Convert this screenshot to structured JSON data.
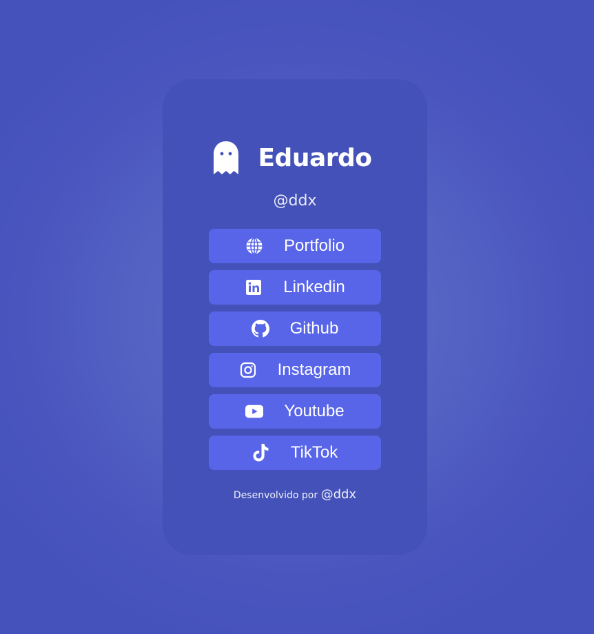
{
  "profile": {
    "name": "Eduardo",
    "handle": "@ddx",
    "avatar_icon": "ghost-icon"
  },
  "links": [
    {
      "label": "Portfolio",
      "icon": "globe-icon"
    },
    {
      "label": "Linkedin",
      "icon": "linkedin-icon"
    },
    {
      "label": "Github",
      "icon": "github-icon"
    },
    {
      "label": "Instagram",
      "icon": "instagram-icon"
    },
    {
      "label": "Youtube",
      "icon": "youtube-icon"
    },
    {
      "label": "TikTok",
      "icon": "tiktok-icon"
    }
  ],
  "footer": {
    "text": "Desenvolvido por",
    "author": "@ddx"
  },
  "colors": {
    "background": "#5462c3",
    "card": "#4451b8",
    "button": "#5865e8",
    "text": "#ffffff"
  }
}
